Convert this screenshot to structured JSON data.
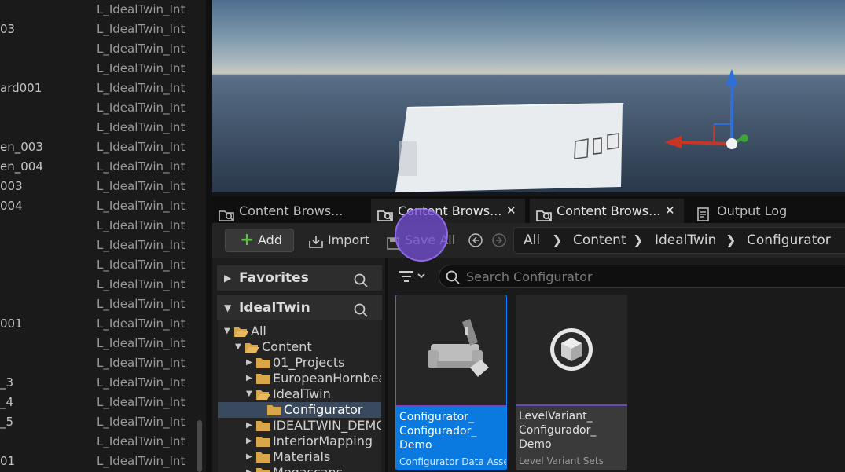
{
  "outliner": {
    "rows": [
      {
        "name": "",
        "level": "L_IdealTwin_Int"
      },
      {
        "name": "03",
        "level": "L_IdealTwin_Int"
      },
      {
        "name": "",
        "level": "L_IdealTwin_Int"
      },
      {
        "name": "",
        "level": "L_IdealTwin_Int"
      },
      {
        "name": "ard001",
        "level": "L_IdealTwin_Int"
      },
      {
        "name": "",
        "level": "L_IdealTwin_Int"
      },
      {
        "name": "",
        "level": "L_IdealTwin_Int"
      },
      {
        "name": "en_003",
        "level": "L_IdealTwin_Int"
      },
      {
        "name": "en_004",
        "level": "L_IdealTwin_Int"
      },
      {
        "name": "003",
        "level": "L_IdealTwin_Int"
      },
      {
        "name": "004",
        "level": "L_IdealTwin_Int"
      },
      {
        "name": "",
        "level": "L_IdealTwin_Int"
      },
      {
        "name": "",
        "level": "L_IdealTwin_Int"
      },
      {
        "name": "",
        "level": "L_IdealTwin_Int"
      },
      {
        "name": "",
        "level": "L_IdealTwin_Int"
      },
      {
        "name": "",
        "level": "L_IdealTwin_Int"
      },
      {
        "name": "001",
        "level": "L_IdealTwin_Int"
      },
      {
        "name": "",
        "level": "L_IdealTwin_Int"
      },
      {
        "name": "",
        "level": "L_IdealTwin_Int"
      },
      {
        "name": "_3",
        "level": "L_IdealTwin_Int"
      },
      {
        "name": "_4",
        "level": "L_IdealTwin_Int"
      },
      {
        "name": "_5",
        "level": "L_IdealTwin_Int"
      },
      {
        "name": "",
        "level": "L_IdealTwin_Int"
      },
      {
        "name": "01",
        "level": "L_IdealTwin_Int"
      }
    ]
  },
  "tabs": [
    {
      "label": "Content Brows...",
      "closable": false,
      "active": false,
      "icon": "content-browser-icon"
    },
    {
      "label": "Content Brows...",
      "closable": true,
      "active": true,
      "icon": "content-browser-icon"
    },
    {
      "label": "Content Brows...",
      "closable": true,
      "active": true,
      "icon": "content-browser-icon"
    },
    {
      "label": "Output Log",
      "closable": false,
      "active": false,
      "icon": "output-log-icon"
    }
  ],
  "toolbar": {
    "add_label": "Add",
    "import_label": "Import",
    "save_all_label": "Save All"
  },
  "breadcrumb": [
    "All",
    "Content",
    "IdealTwin",
    "Configurator"
  ],
  "sources": {
    "favorites_label": "Favorites",
    "root_label": "IdealTwin",
    "tree": [
      {
        "label": "All",
        "depth": 0,
        "expanded": true,
        "open_folder": true,
        "selected": false
      },
      {
        "label": "Content",
        "depth": 1,
        "expanded": true,
        "open_folder": true,
        "selected": false
      },
      {
        "label": "01_Projects",
        "depth": 2,
        "expanded": false,
        "open_folder": false,
        "selected": false
      },
      {
        "label": "EuropeanHornbea",
        "depth": 2,
        "expanded": false,
        "open_folder": false,
        "selected": false
      },
      {
        "label": "IdealTwin",
        "depth": 2,
        "expanded": true,
        "open_folder": true,
        "selected": false
      },
      {
        "label": "Configurator",
        "depth": 3,
        "expanded": null,
        "open_folder": false,
        "selected": true
      },
      {
        "label": "IDEALTWIN_DEMO",
        "depth": 2,
        "expanded": false,
        "open_folder": false,
        "selected": false
      },
      {
        "label": "InteriorMapping",
        "depth": 2,
        "expanded": false,
        "open_folder": false,
        "selected": false
      },
      {
        "label": "Materials",
        "depth": 2,
        "expanded": false,
        "open_folder": false,
        "selected": false
      },
      {
        "label": "Megascans",
        "depth": 2,
        "expanded": false,
        "open_folder": false,
        "selected": false
      }
    ]
  },
  "search": {
    "placeholder": "Search Configurator",
    "value": ""
  },
  "assets": [
    {
      "name": "Configurator_\nConfigurador_\nDemo",
      "type": "Configurator Data Asset",
      "selected": true,
      "icon": "configurator-asset-icon"
    },
    {
      "name": "LevelVariant_\nConfigurador_\nDemo",
      "type": "Level Variant Sets",
      "selected": false,
      "icon": "level-variant-sets-icon"
    }
  ],
  "colors": {
    "selection_blue": "#0a7ae0",
    "add_green": "#5fbf46",
    "cursor_halo": "#7850dc",
    "folder": "#d9a74a"
  }
}
